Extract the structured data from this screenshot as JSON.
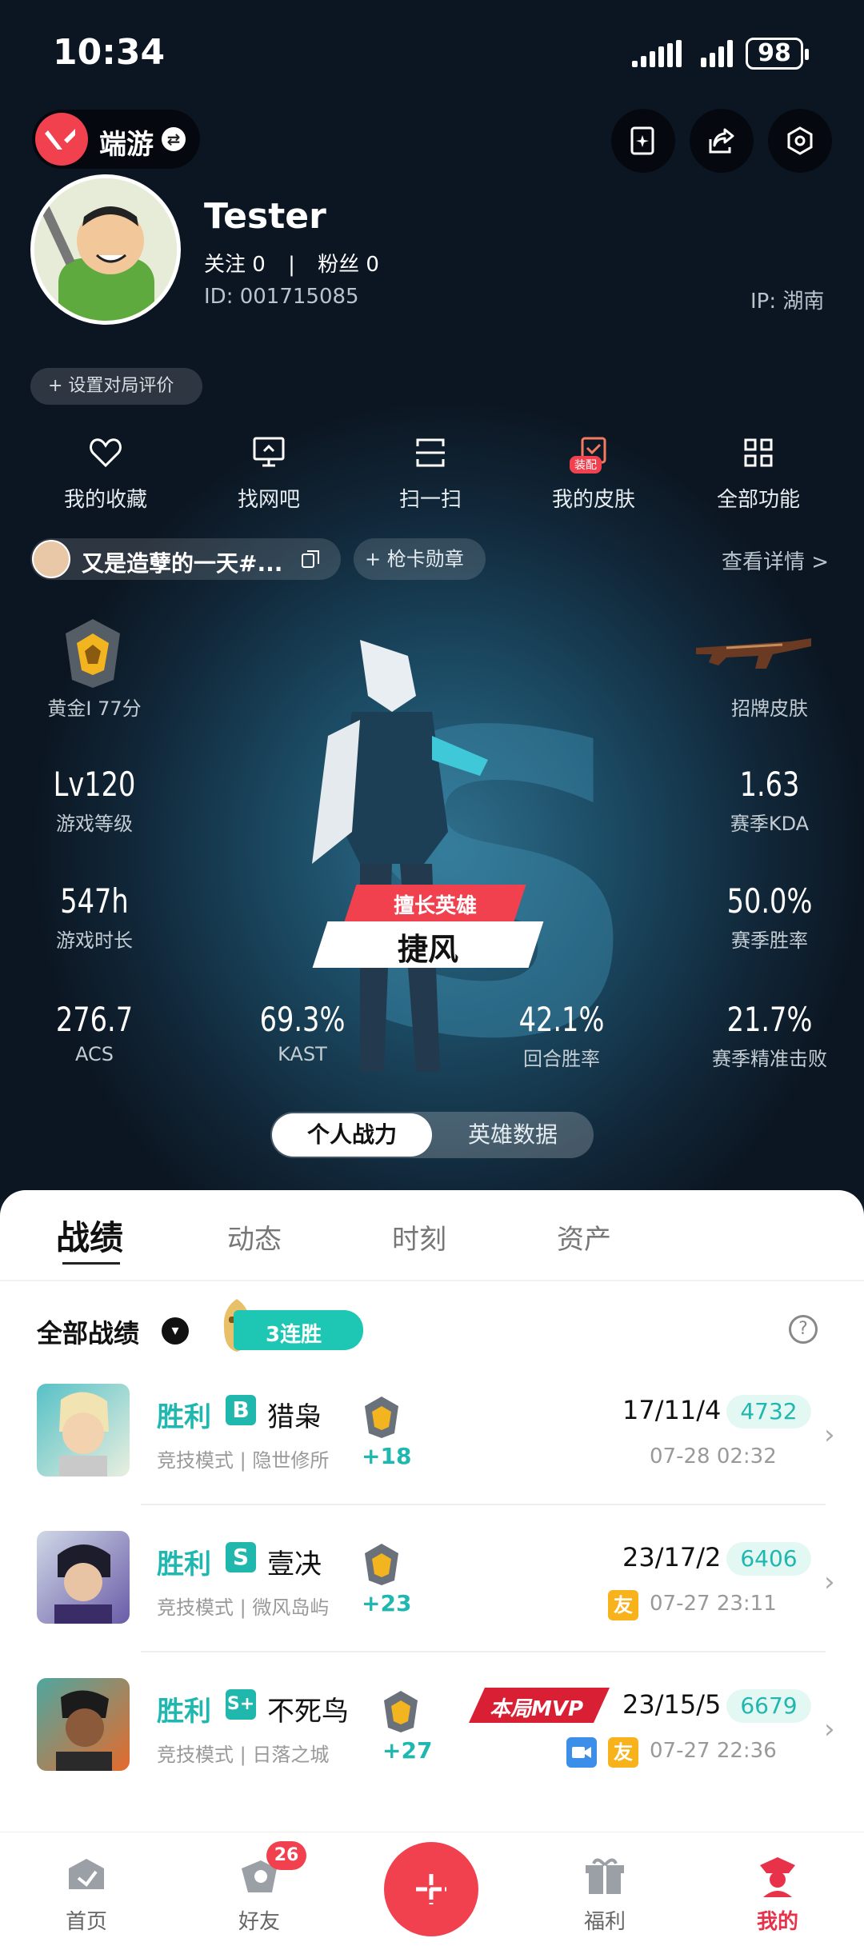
{
  "status_bar": {
    "time": "10:34",
    "battery": "98"
  },
  "header": {
    "brand": "端游"
  },
  "profile": {
    "name": "Tester",
    "follow": "关注 0",
    "fans": "粉丝 0",
    "divider": "|",
    "id": "ID:  001715085",
    "ip": "IP:  湖南",
    "rate_button": "+ 设置对局评价"
  },
  "tools": [
    {
      "label": "我的收藏",
      "icon": "heart-icon"
    },
    {
      "label": "找网吧",
      "icon": "monitor-icon"
    },
    {
      "label": "扫一扫",
      "icon": "scan-icon"
    },
    {
      "label": "我的皮肤",
      "icon": "skin-icon",
      "badge": "装配"
    },
    {
      "label": "全部功能",
      "icon": "grid-icon"
    }
  ],
  "subheader": {
    "player": "又是造孽的一天#...",
    "card_button": "+ 枪卡勋章",
    "detail": "查看详情 >"
  },
  "stats": {
    "rank": "黄金I 77分",
    "skin": "招牌皮肤",
    "level_val": "Lv120",
    "level_lbl": "游戏等级",
    "kda_val": "1.63",
    "kda_lbl": "赛季KDA",
    "time_val": "547h",
    "time_lbl": "游戏时长",
    "win_val": "50.0%",
    "win_lbl": "赛季胜率",
    "acs_val": "276.7",
    "acs_lbl": "ACS",
    "kast_val": "69.3%",
    "kast_lbl": "KAST",
    "round_val": "42.1%",
    "round_lbl": "回合胜率",
    "hs_val": "21.7%",
    "hs_lbl": "赛季精准击败",
    "hero_tag": "擅长英雄",
    "hero_name": "捷风",
    "letter": "S"
  },
  "toggle": {
    "on": "个人战力",
    "off": "英雄数据"
  },
  "tabs": [
    {
      "label": "战绩",
      "active": true
    },
    {
      "label": "动态"
    },
    {
      "label": "时刻"
    },
    {
      "label": "资产"
    }
  ],
  "records": {
    "filter": "全部战绩",
    "streak": "3连胜",
    "help": "?",
    "items": [
      {
        "result": "胜利",
        "grade": "B",
        "hero": "猎枭",
        "mode": "竞技模式 | 隐世修所",
        "delta": "+18",
        "kda": "17/11/4",
        "score": "4732",
        "date": "07-28 02:32"
      },
      {
        "result": "胜利",
        "grade": "S",
        "hero": "壹决",
        "mode": "竞技模式 | 微风岛屿",
        "delta": "+23",
        "kda": "23/17/2",
        "score": "6406",
        "date": "07-27 23:11",
        "tag": "友"
      },
      {
        "result": "胜利",
        "grade": "S+",
        "hero": "不死鸟",
        "mode": "竞技模式 | 日落之城",
        "delta": "+27",
        "kda": "23/15/5",
        "score": "6679",
        "date": "07-27 22:36",
        "tag": "友",
        "mvp": "本局MVP"
      }
    ]
  },
  "bottom_nav": [
    {
      "label": "首页",
      "icon": "home-icon"
    },
    {
      "label": "好友",
      "icon": "friends-icon",
      "badge": "26"
    },
    {
      "label": "",
      "icon": "plus-icon"
    },
    {
      "label": "福利",
      "icon": "gift-icon"
    },
    {
      "label": "我的",
      "icon": "profile-icon",
      "active": true
    }
  ],
  "colors": {
    "accent": "#f1414f",
    "teal": "#21b7b1",
    "bg": "#0e1a26"
  }
}
